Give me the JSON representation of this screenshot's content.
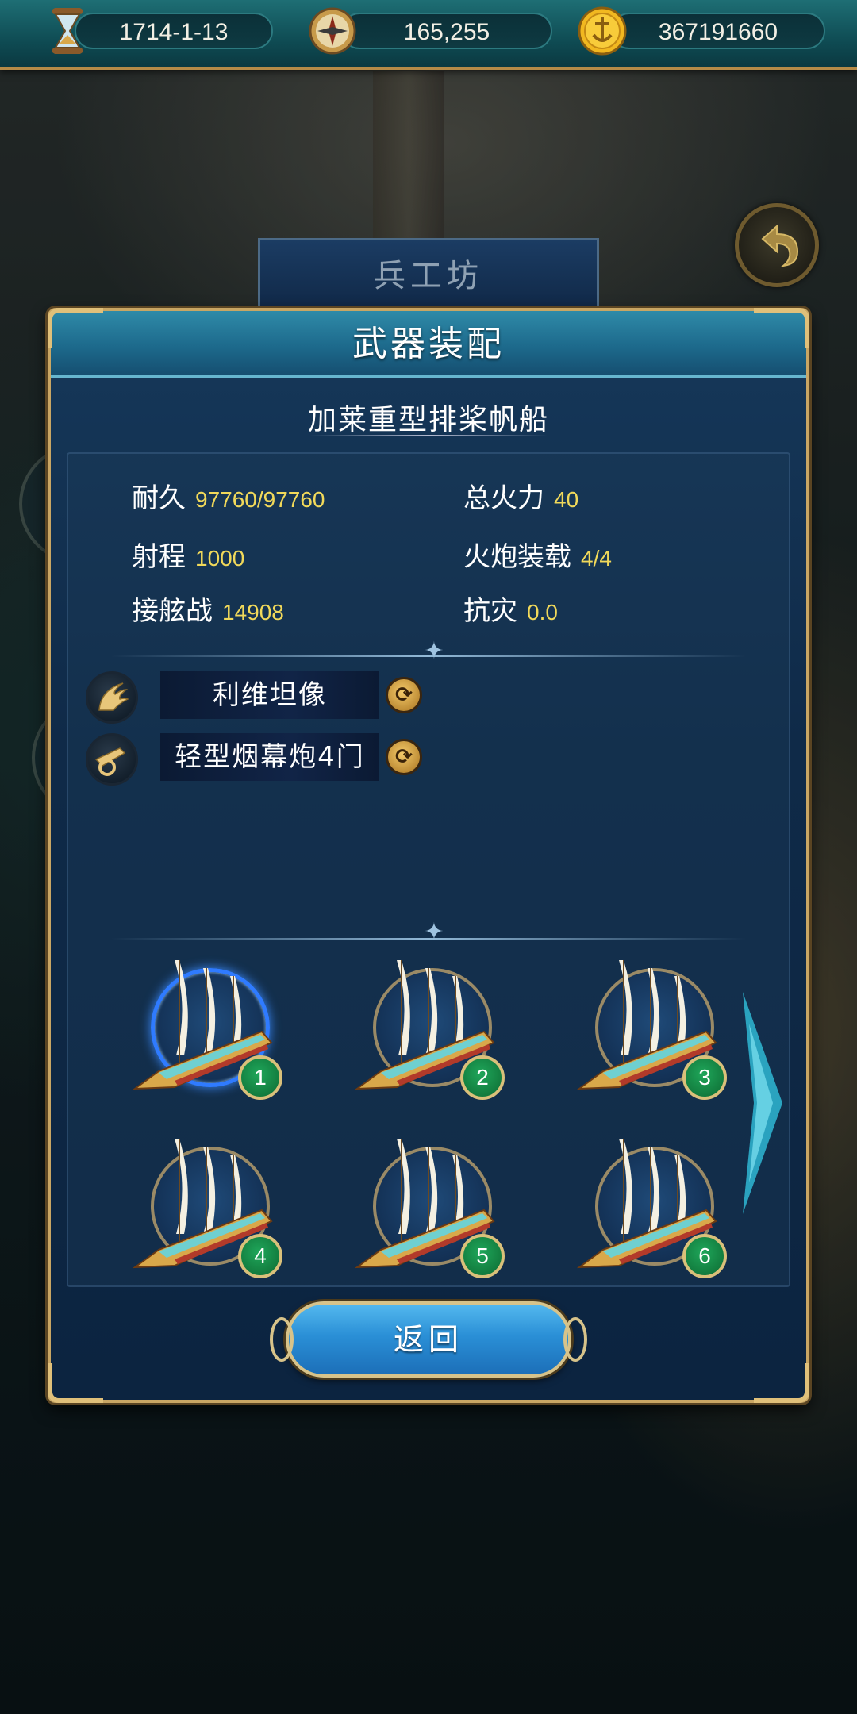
{
  "topbar": {
    "date": "1714-1-13",
    "compass_value": "165,255",
    "gold": "367191660",
    "icons": [
      "hourglass-icon",
      "compass-icon",
      "anchor-coin-icon"
    ]
  },
  "background": {
    "workshop_title": "兵工坊"
  },
  "panel": {
    "title": "武器装配",
    "ship_name": "加莱重型排桨帆船"
  },
  "stats": [
    {
      "label": "耐久",
      "value": "97760/97760"
    },
    {
      "label": "总火力",
      "value": "40"
    },
    {
      "label": "射程",
      "value": "1000"
    },
    {
      "label": "火炮装载",
      "value": "4/4"
    },
    {
      "label": "接舷战",
      "value": "14908"
    },
    {
      "label": "抗灾",
      "value": "0.0"
    }
  ],
  "equipment": [
    {
      "icon": "wing-ornament-icon",
      "name": "利维坦像"
    },
    {
      "icon": "cannon-icon",
      "name": "轻型烟幕炮4门"
    }
  ],
  "ships": [
    {
      "number": "1",
      "selected": true
    },
    {
      "number": "2",
      "selected": false
    },
    {
      "number": "3",
      "selected": false
    },
    {
      "number": "4",
      "selected": false
    },
    {
      "number": "5",
      "selected": false
    },
    {
      "number": "6",
      "selected": false
    }
  ],
  "buttons": {
    "return_label": "返回"
  },
  "colors": {
    "stat_value": "#f1d95a",
    "selected_ring": "#2f7bff",
    "badge_green": "#1fa65a",
    "frame_gold": "#c9a664"
  }
}
